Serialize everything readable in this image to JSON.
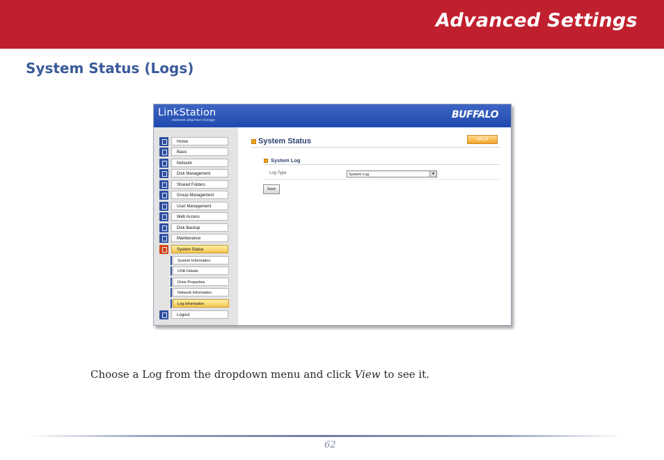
{
  "banner": {
    "title": "Advanced Settings"
  },
  "section_title": "System Status (Logs)",
  "screenshot": {
    "logo": "LinkStation",
    "logo_sub": "network attached storage",
    "brand": "BUFFALO",
    "nav": [
      {
        "label": "Home",
        "icon": "home-icon"
      },
      {
        "label": "Basic",
        "icon": "basic-icon"
      },
      {
        "label": "Network",
        "icon": "network-icon"
      },
      {
        "label": "Disk Management",
        "icon": "disk-icon"
      },
      {
        "label": "Shared Folders",
        "icon": "folder-icon"
      },
      {
        "label": "Group Management",
        "icon": "group-icon"
      },
      {
        "label": "User Management",
        "icon": "user-icon"
      },
      {
        "label": "Web Access",
        "icon": "web-icon"
      },
      {
        "label": "Disk Backup",
        "icon": "backup-icon"
      },
      {
        "label": "Maintenance",
        "icon": "maintenance-icon"
      },
      {
        "label": "System Status",
        "icon": "status-icon",
        "active": true
      }
    ],
    "subnav": [
      {
        "label": "System Information"
      },
      {
        "label": "USB Details"
      },
      {
        "label": "Drive Properties"
      },
      {
        "label": "Network Information"
      },
      {
        "label": "Log Information",
        "active": true
      }
    ],
    "logout": "Logout",
    "page_heading": "System Status",
    "help": "HELP",
    "sub_heading": "System Log",
    "log_type_label": "Log Type",
    "log_type_value": "System Log",
    "save": "Save"
  },
  "instruction": {
    "before": "Choose a Log from the dropdown menu and click",
    "em": "View",
    "after": "to see it."
  },
  "page_number": "62"
}
